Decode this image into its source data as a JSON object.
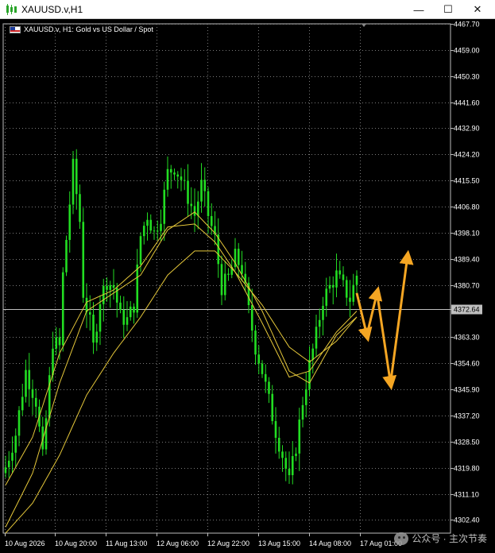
{
  "window": {
    "title": "XAUUSD.v,H1",
    "minimize_glyph": "—",
    "maximize_glyph": "☐",
    "close_glyph": "✕"
  },
  "chart_label": "XAUUSD.v, H1:  Gold vs US Dollar / Spot",
  "watermark": "公众号 · 主次节奏",
  "colors": {
    "background": "#000000",
    "grid": "#7a7a7a",
    "candles": "#22dd22",
    "moving_averages": "#e6c83a",
    "forecast_arrows": "#f5a623",
    "price_tag": "#bfbfbf",
    "axis_text": "#ffffff"
  },
  "chart_data": {
    "type": "line",
    "symbol": "XAUUSD.v",
    "timeframe": "H1",
    "grid": true,
    "y_ticks": [
      "4467.70",
      "4459.00",
      "4450.30",
      "4441.60",
      "4432.90",
      "4424.20",
      "4415.50",
      "4406.80",
      "4398.10",
      "4389.40",
      "4380.70",
      "4372.64",
      "4363.30",
      "4354.60",
      "4345.90",
      "4337.20",
      "4328.50",
      "4319.80",
      "4311.10",
      "4302.40"
    ],
    "ylim": [
      4298.0,
      4467.7
    ],
    "current_price": "4372.64",
    "x_ticks": [
      "10 Aug 2026",
      "10 Aug 20:00",
      "11 Aug 13:00",
      "12 Aug 06:00",
      "12 Aug 22:00",
      "13 Aug 15:00",
      "14 Aug 08:00",
      "17 Aug 01:00"
    ],
    "bar_count": 112,
    "close_anchors": [
      [
        0,
        4320
      ],
      [
        3,
        4331
      ],
      [
        6,
        4352
      ],
      [
        9,
        4342
      ],
      [
        11,
        4323
      ],
      [
        14,
        4362
      ],
      [
        16,
        4360
      ],
      [
        17,
        4384
      ],
      [
        18,
        4396
      ],
      [
        20,
        4420
      ],
      [
        22,
        4402
      ],
      [
        23,
        4378
      ],
      [
        25,
        4368
      ],
      [
        26,
        4360
      ],
      [
        28,
        4376
      ],
      [
        30,
        4382
      ],
      [
        32,
        4380
      ],
      [
        34,
        4370
      ],
      [
        36,
        4369
      ],
      [
        38,
        4374
      ],
      [
        40,
        4397
      ],
      [
        42,
        4404
      ],
      [
        44,
        4398
      ],
      [
        46,
        4404
      ],
      [
        48,
        4418
      ],
      [
        50,
        4420
      ],
      [
        52,
        4416
      ],
      [
        54,
        4410
      ],
      [
        56,
        4404
      ],
      [
        58,
        4414
      ],
      [
        60,
        4404
      ],
      [
        62,
        4396
      ],
      [
        64,
        4380
      ],
      [
        66,
        4383
      ],
      [
        68,
        4390
      ],
      [
        70,
        4386
      ],
      [
        72,
        4372
      ],
      [
        74,
        4360
      ],
      [
        76,
        4352
      ],
      [
        78,
        4342
      ],
      [
        80,
        4332
      ],
      [
        82,
        4324
      ],
      [
        84,
        4315
      ],
      [
        86,
        4327
      ],
      [
        88,
        4342
      ],
      [
        90,
        4354
      ],
      [
        92,
        4364
      ],
      [
        94,
        4376
      ],
      [
        96,
        4380
      ],
      [
        98,
        4384
      ],
      [
        100,
        4380
      ],
      [
        102,
        4376
      ],
      [
        104,
        4384
      ]
    ],
    "series": [
      {
        "name": "",
        "anchors": [
          [
            0,
            4300
          ],
          [
            8,
            4318
          ],
          [
            16,
            4348
          ],
          [
            24,
            4372
          ],
          [
            32,
            4378
          ],
          [
            40,
            4384
          ],
          [
            48,
            4399
          ],
          [
            56,
            4405
          ],
          [
            62,
            4398
          ],
          [
            68,
            4388
          ],
          [
            76,
            4372
          ],
          [
            84,
            4352
          ],
          [
            90,
            4348
          ],
          [
            98,
            4364
          ],
          [
            104,
            4370
          ]
        ]
      },
      {
        "name": "",
        "anchors": [
          [
            0,
            4314
          ],
          [
            8,
            4330
          ],
          [
            16,
            4358
          ],
          [
            24,
            4375
          ],
          [
            32,
            4379
          ],
          [
            40,
            4387
          ],
          [
            48,
            4400
          ],
          [
            56,
            4401
          ],
          [
            62,
            4395
          ],
          [
            68,
            4385
          ],
          [
            76,
            4368
          ],
          [
            84,
            4350
          ],
          [
            90,
            4352
          ],
          [
            98,
            4365
          ],
          [
            104,
            4372
          ]
        ]
      },
      {
        "name": "",
        "anchors": [
          [
            0,
            4298
          ],
          [
            8,
            4308
          ],
          [
            16,
            4324
          ],
          [
            24,
            4344
          ],
          [
            32,
            4358
          ],
          [
            40,
            4370
          ],
          [
            48,
            4384
          ],
          [
            56,
            4392
          ],
          [
            62,
            4392
          ],
          [
            68,
            4385
          ],
          [
            76,
            4374
          ],
          [
            84,
            4360
          ],
          [
            90,
            4355
          ],
          [
            98,
            4362
          ],
          [
            104,
            4370
          ]
        ]
      }
    ],
    "forecast_path": [
      {
        "from": [
          104,
          4378
        ],
        "to": [
          107,
          4364
        ]
      },
      {
        "from": [
          107,
          4364
        ],
        "to": [
          110,
          4378
        ]
      },
      {
        "from": [
          110,
          4378
        ],
        "to": [
          114,
          4348
        ]
      },
      {
        "from": [
          114,
          4348
        ],
        "to": [
          119,
          4390
        ]
      }
    ]
  }
}
